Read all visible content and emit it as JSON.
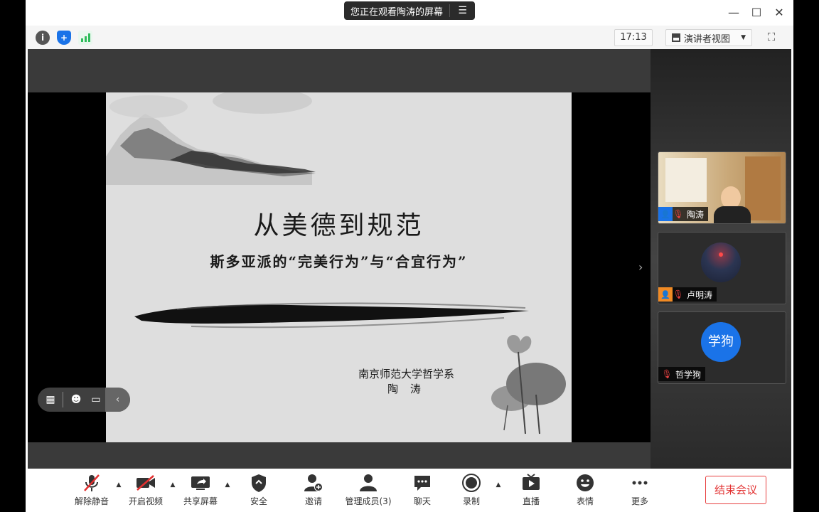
{
  "share_banner": {
    "text": "您正在观看陶涛的屏幕",
    "menu_icon": "menu-icon"
  },
  "window_controls": {
    "minimize": "—",
    "maximize": "☐",
    "close": "✕"
  },
  "toolbar": {
    "info_icon": "info-icon",
    "security_icon": "shield-icon",
    "signal_icon": "signal-icon",
    "time": "17:13",
    "view_mode": "演讲者视图",
    "fullscreen_icon": "fullscreen-icon"
  },
  "slide": {
    "title": "从美德到规范",
    "subtitle": "斯多亚派的“完美行为”与“合宜行为”",
    "institution": "南京师范大学哲学系",
    "author": "陶 涛"
  },
  "participants": [
    {
      "name": "陶涛",
      "video": true,
      "mic_muted": true
    },
    {
      "name": "卢明涛",
      "video": false,
      "mic_muted": true
    },
    {
      "name": "哲学狗",
      "avatar_text": "学狗",
      "video": false,
      "mic_muted": true
    }
  ],
  "bottom_toolbar": {
    "unmute": "解除静音",
    "start_video": "开启视频",
    "share_screen": "共享屏幕",
    "security": "安全",
    "invite": "邀请",
    "manage_members": "管理成员(3)",
    "chat": "聊天",
    "record": "录制",
    "live": "直播",
    "reactions": "表情",
    "more": "更多",
    "end_meeting": "结束会议"
  },
  "colors": {
    "end_red": "#e23030",
    "avatar_blue": "#1a73e8",
    "signal_green": "#2dbd5a"
  }
}
